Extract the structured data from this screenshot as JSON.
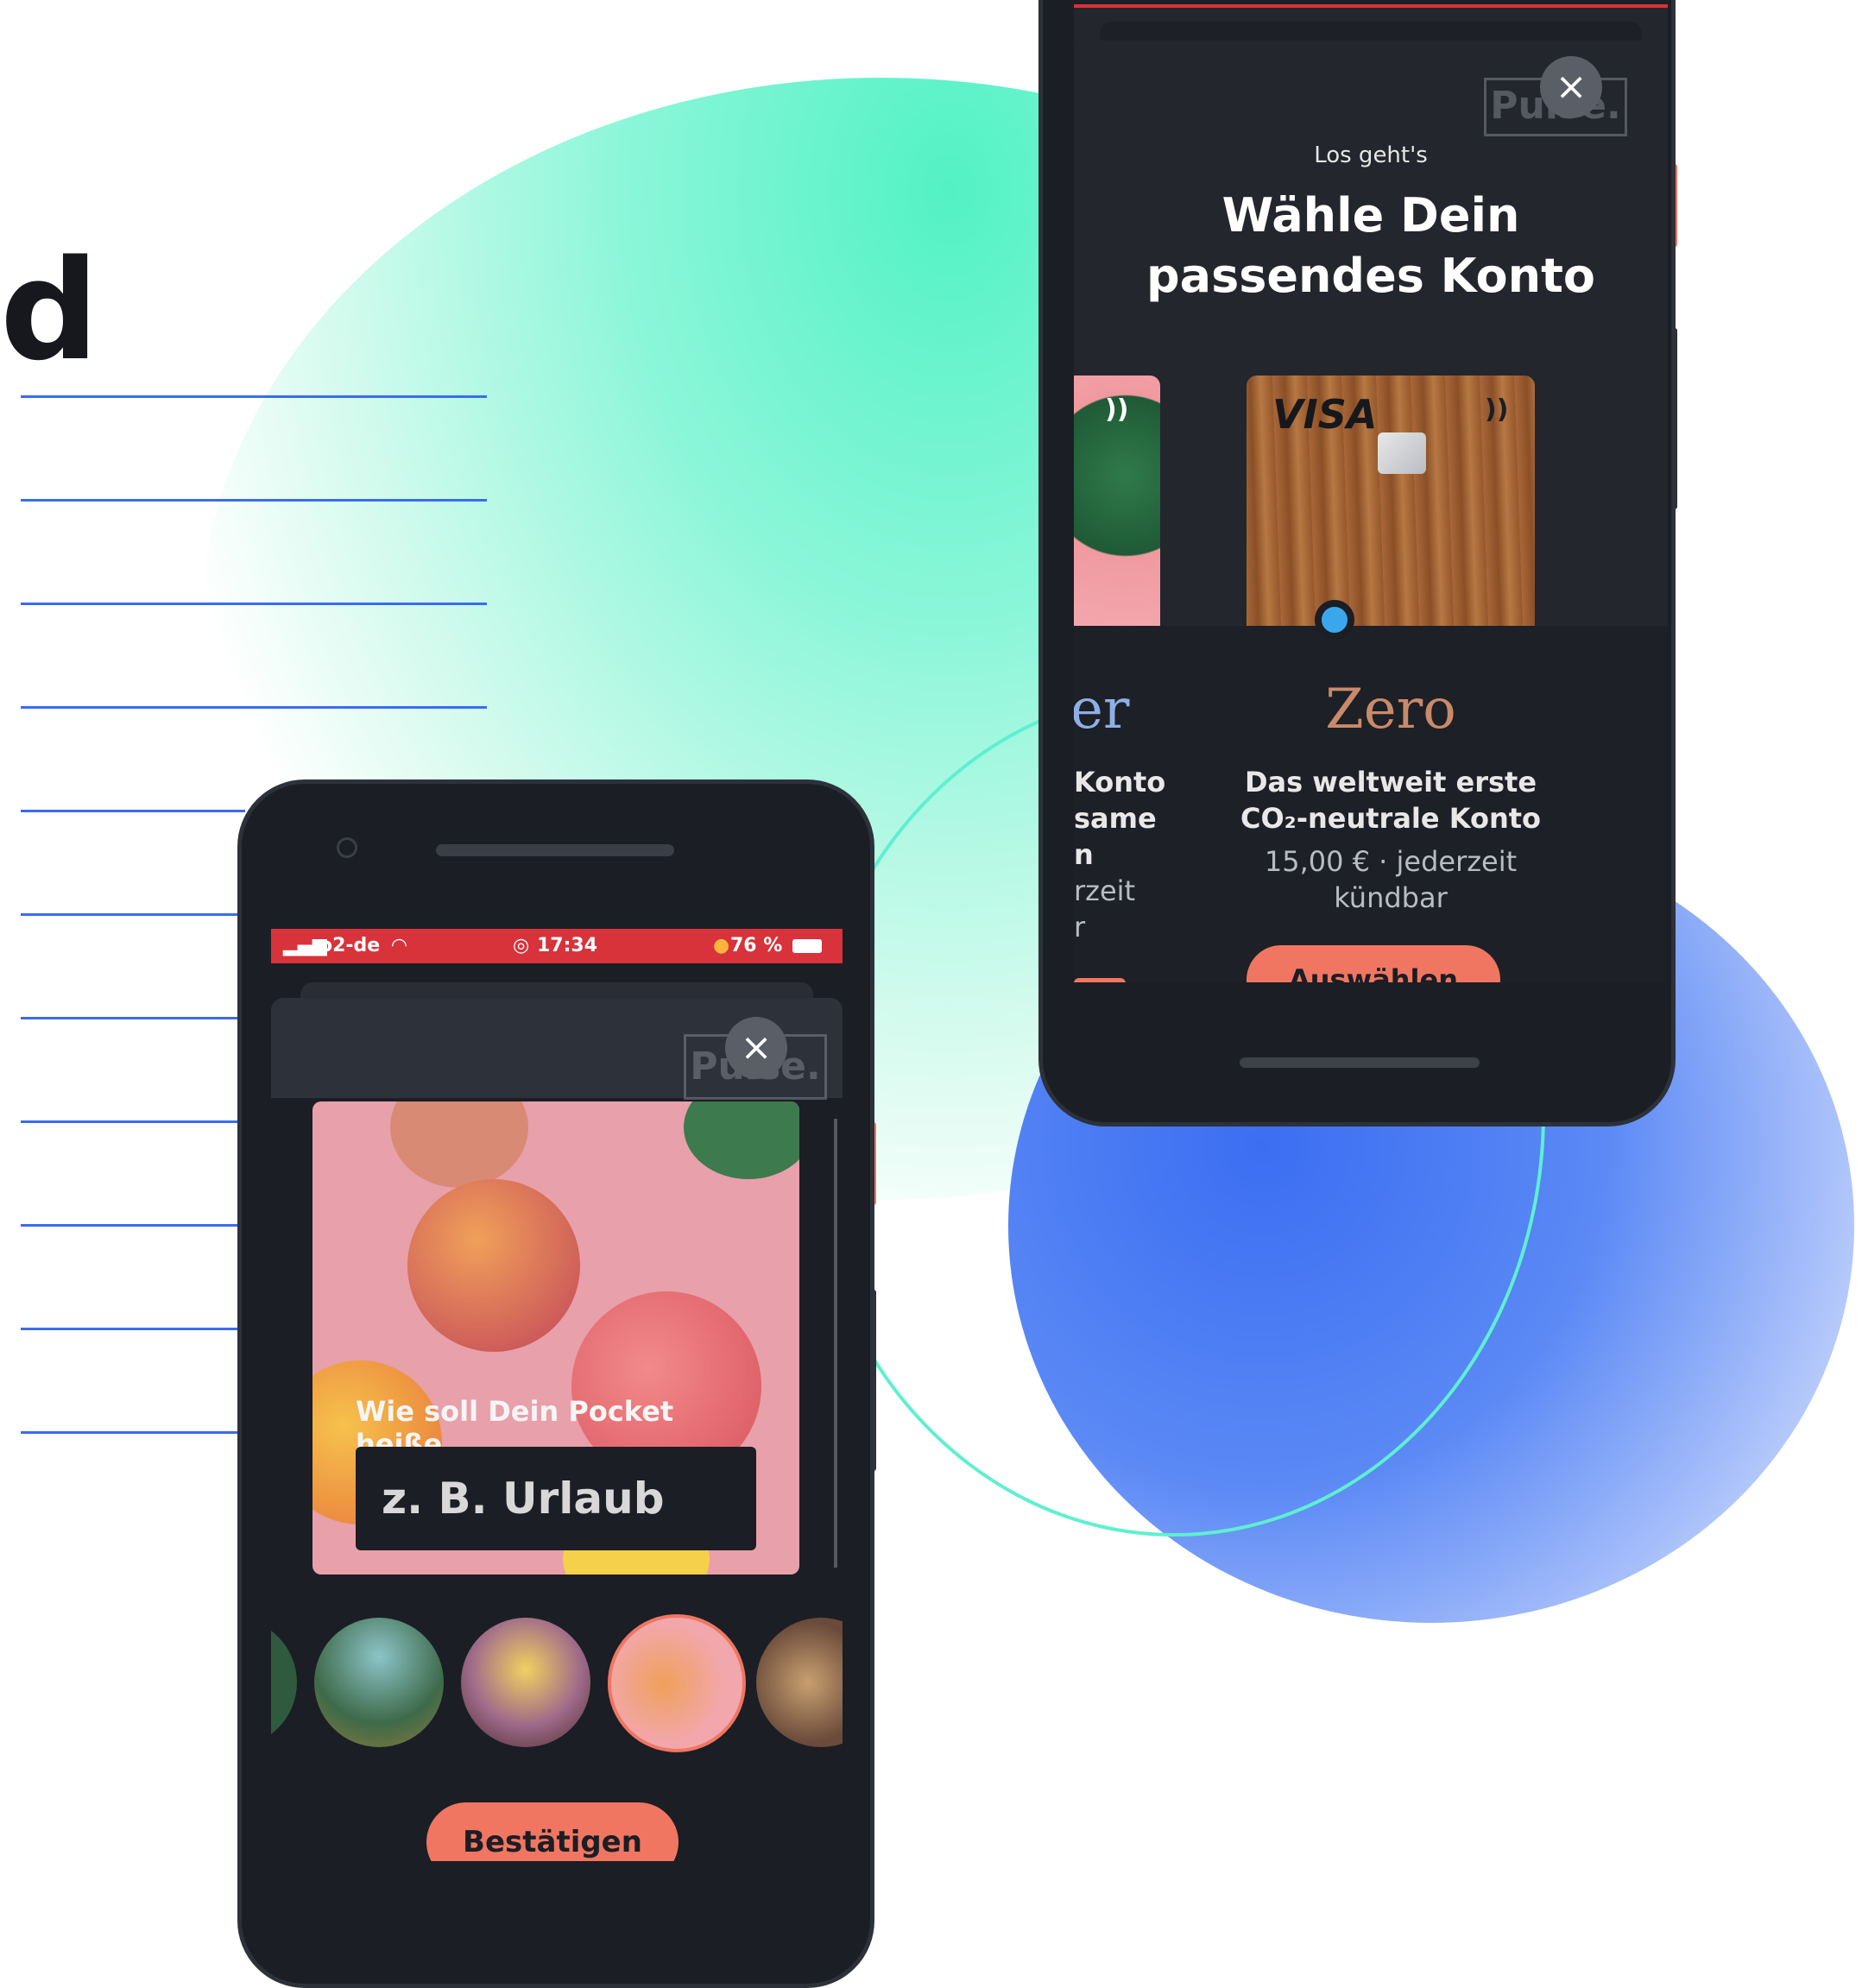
{
  "heading_fragment": "d",
  "right_phone": {
    "subtitle": "Los geht's",
    "title_line1": "Wähle Dein",
    "title_line2": "passendes Konto",
    "badge_logo": "Pulse.",
    "close_glyph": "×",
    "card_brand": "VISA",
    "contactless_glyph": "))",
    "partial_card": {
      "name_fragment": "er",
      "line1": "Konto",
      "line2": "same",
      "line3": "n",
      "line4": "rzeit",
      "line5": "r"
    },
    "selected_card": {
      "name": "Zero",
      "description_line1": "Das weltweit erste",
      "description_line2": "CO₂-neutrale Konto",
      "price_line1": "15,00 € · jederzeit",
      "price_line2": "kündbar",
      "cta_label": "Auswählen"
    }
  },
  "left_phone": {
    "status": {
      "carrier": "o2-de",
      "time": "17:34",
      "battery": "76 %"
    },
    "badge_logo": "Pulse.",
    "close_glyph": "×",
    "input_label": "Wie soll Dein Pocket heiße...",
    "input_placeholder": "z. B. Urlaub",
    "confirm_label": "Bestätigen"
  },
  "colors": {
    "accent": "#f07662",
    "status_bar": "#d8323b",
    "screen_bg": "#1b1e24",
    "selector_dot": "#3aa7ec"
  }
}
